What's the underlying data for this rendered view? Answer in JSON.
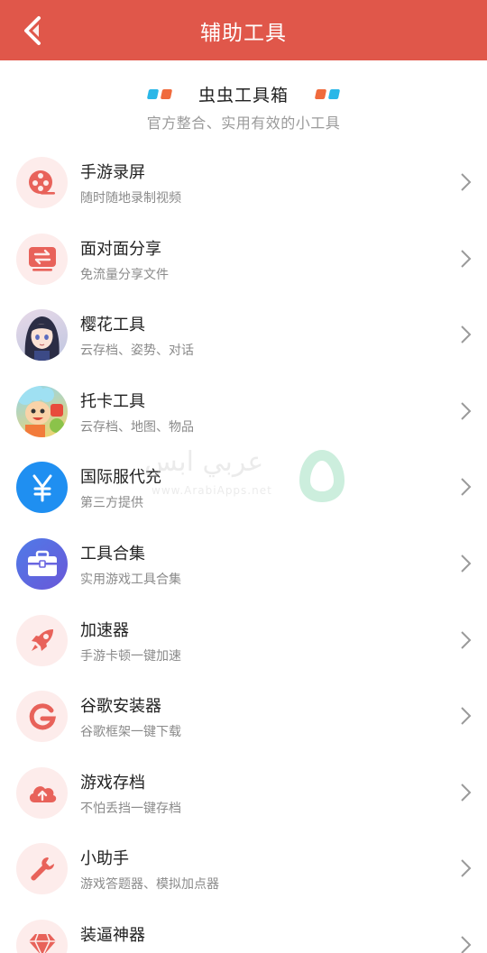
{
  "header": {
    "title": "辅助工具",
    "back_icon": "chevron-left-icon"
  },
  "banner": {
    "title": "虫虫工具箱",
    "subtitle": "官方整合、实用有效的小工具",
    "accent_colors": [
      "#2ab7e8",
      "#f06a3c"
    ]
  },
  "items": [
    {
      "title": "手游录屏",
      "subtitle": "随时随地录制视频",
      "icon": "film-reel-icon"
    },
    {
      "title": "面对面分享",
      "subtitle": "免流量分享文件",
      "icon": "transfer-icon"
    },
    {
      "title": "樱花工具",
      "subtitle": "云存档、姿势、对话",
      "icon": "anime-avatar-icon"
    },
    {
      "title": "托卡工具",
      "subtitle": "云存档、地图、物品",
      "icon": "toca-avatar-icon"
    },
    {
      "title": "国际服代充",
      "subtitle": "第三方提供",
      "icon": "yen-icon"
    },
    {
      "title": "工具合集",
      "subtitle": "实用游戏工具合集",
      "icon": "toolbox-icon"
    },
    {
      "title": "加速器",
      "subtitle": "手游卡顿一键加速",
      "icon": "rocket-icon"
    },
    {
      "title": "谷歌安装器",
      "subtitle": "谷歌框架一键下载",
      "icon": "google-g-icon"
    },
    {
      "title": "游戏存档",
      "subtitle": "不怕丢挡一键存档",
      "icon": "cloud-upload-icon"
    },
    {
      "title": "小助手",
      "subtitle": "游戏答题器、模拟加点器",
      "icon": "wrench-icon"
    },
    {
      "title": "装逼神器",
      "subtitle": "",
      "icon": "diamond-icon"
    }
  ],
  "watermark": {
    "arabic": "عربي ابس",
    "latin": "www.ArabiApps.net"
  },
  "colors": {
    "header_bg": "#e0574a",
    "icon_accent": "#e8625a",
    "icon_bg": "#fdeceb"
  }
}
